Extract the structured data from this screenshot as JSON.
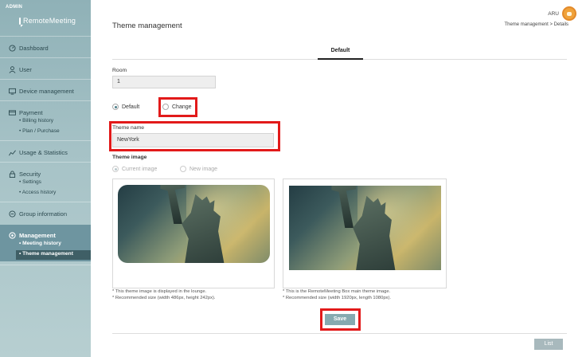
{
  "sidebar": {
    "admin_label": "ADMIN",
    "logo_text": "RemoteMeeting",
    "items": [
      {
        "label": "Dashboard",
        "icon": "dashboard-icon"
      },
      {
        "label": "User",
        "icon": "user-icon"
      },
      {
        "label": "Device management",
        "icon": "device-icon"
      },
      {
        "label": "Payment",
        "icon": "payment-icon",
        "subs": [
          "Billing history",
          "Plan / Purchase"
        ]
      },
      {
        "label": "Usage & Statistics",
        "icon": "chart-icon"
      },
      {
        "label": "Security",
        "icon": "lock-icon",
        "subs": [
          "Settings",
          "Access history"
        ]
      },
      {
        "label": "Group information",
        "icon": "group-icon"
      },
      {
        "label": "Management",
        "icon": "gear-icon",
        "subs": [
          "Meeting history",
          "Theme management"
        ]
      }
    ]
  },
  "header": {
    "title": "Theme management",
    "user_name": "ARU",
    "breadcrumb": "Theme management > Details"
  },
  "tabs": [
    {
      "label": "Default",
      "active": true
    }
  ],
  "form": {
    "room_label": "Room",
    "room_value": "1",
    "mode_options": [
      {
        "label": "Default",
        "selected": true
      },
      {
        "label": "Change",
        "selected": false
      }
    ],
    "theme_name_label": "Theme name",
    "theme_name_value": "NewYork",
    "theme_image_label": "Theme image",
    "image_options": [
      {
        "label": "Current image",
        "selected": true
      },
      {
        "label": "New image",
        "selected": false
      }
    ]
  },
  "images": {
    "lounge_note_1": "* This theme image is displayed in the lounge.",
    "lounge_note_2": "* Recommended size (width 486px, height 242px).",
    "box_note_1": "* This is the RemoteMeeting Box main theme image.",
    "box_note_2": "* Recommended size (width 1920px, length 1080px)."
  },
  "actions": {
    "save_label": "Save",
    "list_label": "List"
  },
  "colors": {
    "sidebar": "#9dbcc1",
    "accent": "#86aab0",
    "highlight_box": "#e21a1a"
  }
}
